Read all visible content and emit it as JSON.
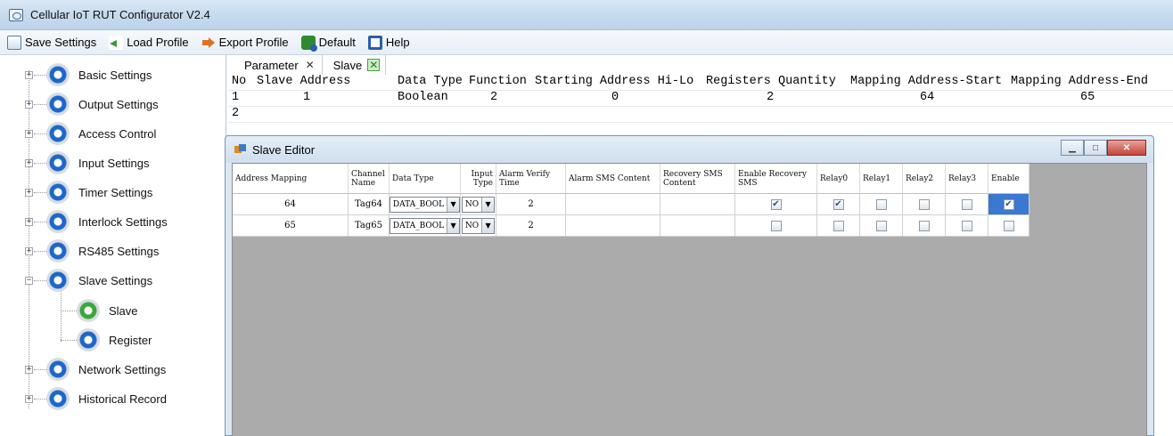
{
  "window": {
    "title": "Cellular IoT RUT Configurator V2.4"
  },
  "toolbar": {
    "save": "Save Settings",
    "load": "Load Profile",
    "export": "Export Profile",
    "default": "Default",
    "help": "Help"
  },
  "sidebar": {
    "items": [
      {
        "label": "Basic Settings",
        "icon": "gear-blue-icon"
      },
      {
        "label": "Output Settings",
        "icon": "gear-blue-icon"
      },
      {
        "label": "Access Control",
        "icon": "gear-blue-icon"
      },
      {
        "label": "Input Settings",
        "icon": "gear-blue-icon"
      },
      {
        "label": "Timer Settings",
        "icon": "gear-blue-icon"
      },
      {
        "label": "Interlock Settings",
        "icon": "gear-blue-icon"
      },
      {
        "label": "RS485 Settings",
        "icon": "gear-blue-icon"
      },
      {
        "label": "Slave Settings",
        "icon": "gear-blue-icon",
        "expanded": true
      },
      {
        "label": "Network Settings",
        "icon": "gear-blue-icon"
      },
      {
        "label": "Historical Record",
        "icon": "gear-blue-icon"
      }
    ],
    "children": [
      {
        "label": "Slave",
        "icon": "gear-green-icon"
      },
      {
        "label": "Register",
        "icon": "gear-blue-icon"
      }
    ]
  },
  "tabs": [
    {
      "label": "Parameter",
      "close": "✕"
    },
    {
      "label": "Slave",
      "close": "✕",
      "active": true
    }
  ],
  "grid": {
    "headers": [
      "No",
      "Slave Address",
      "Data Type",
      "Function",
      "Starting Address Hi-Lo",
      "Registers Quantity",
      "Mapping Address-Start",
      "Mapping Address-End"
    ],
    "rows": [
      [
        "1",
        "1",
        "Boolean",
        "2",
        "0",
        "2",
        "64",
        "65"
      ],
      [
        "2",
        "",
        "",
        "",
        "",
        "",
        "",
        ""
      ]
    ]
  },
  "editor": {
    "title": "Slave Editor",
    "headers": [
      "Address Mapping",
      "Channel Name",
      "Data Type",
      "Input Type",
      "Alarm Verify Time",
      "Alarm SMS Content",
      "Recovery SMS Content",
      "Enable Recovery SMS",
      "Relay0",
      "Relay1",
      "Relay2",
      "Relay3",
      "Enable"
    ],
    "rows": [
      {
        "address": "64",
        "channel": "Tag64",
        "data_type": "DATA_BOOL",
        "input_type": "NO",
        "verify": "2",
        "alarm_sms": "",
        "recovery_sms": "",
        "enable_recovery": true,
        "relay0": true,
        "relay1": false,
        "relay2": false,
        "relay3": false,
        "enable": true
      },
      {
        "address": "65",
        "channel": "Tag65",
        "data_type": "DATA_BOOL",
        "input_type": "NO",
        "verify": "2",
        "alarm_sms": "",
        "recovery_sms": "",
        "enable_recovery": false,
        "relay0": false,
        "relay1": false,
        "relay2": false,
        "relay3": false,
        "enable": false
      }
    ]
  },
  "colors": {
    "accent": "#3a78d2",
    "gear_blue": "#1e67c8",
    "gear_green": "#3aa83a"
  }
}
